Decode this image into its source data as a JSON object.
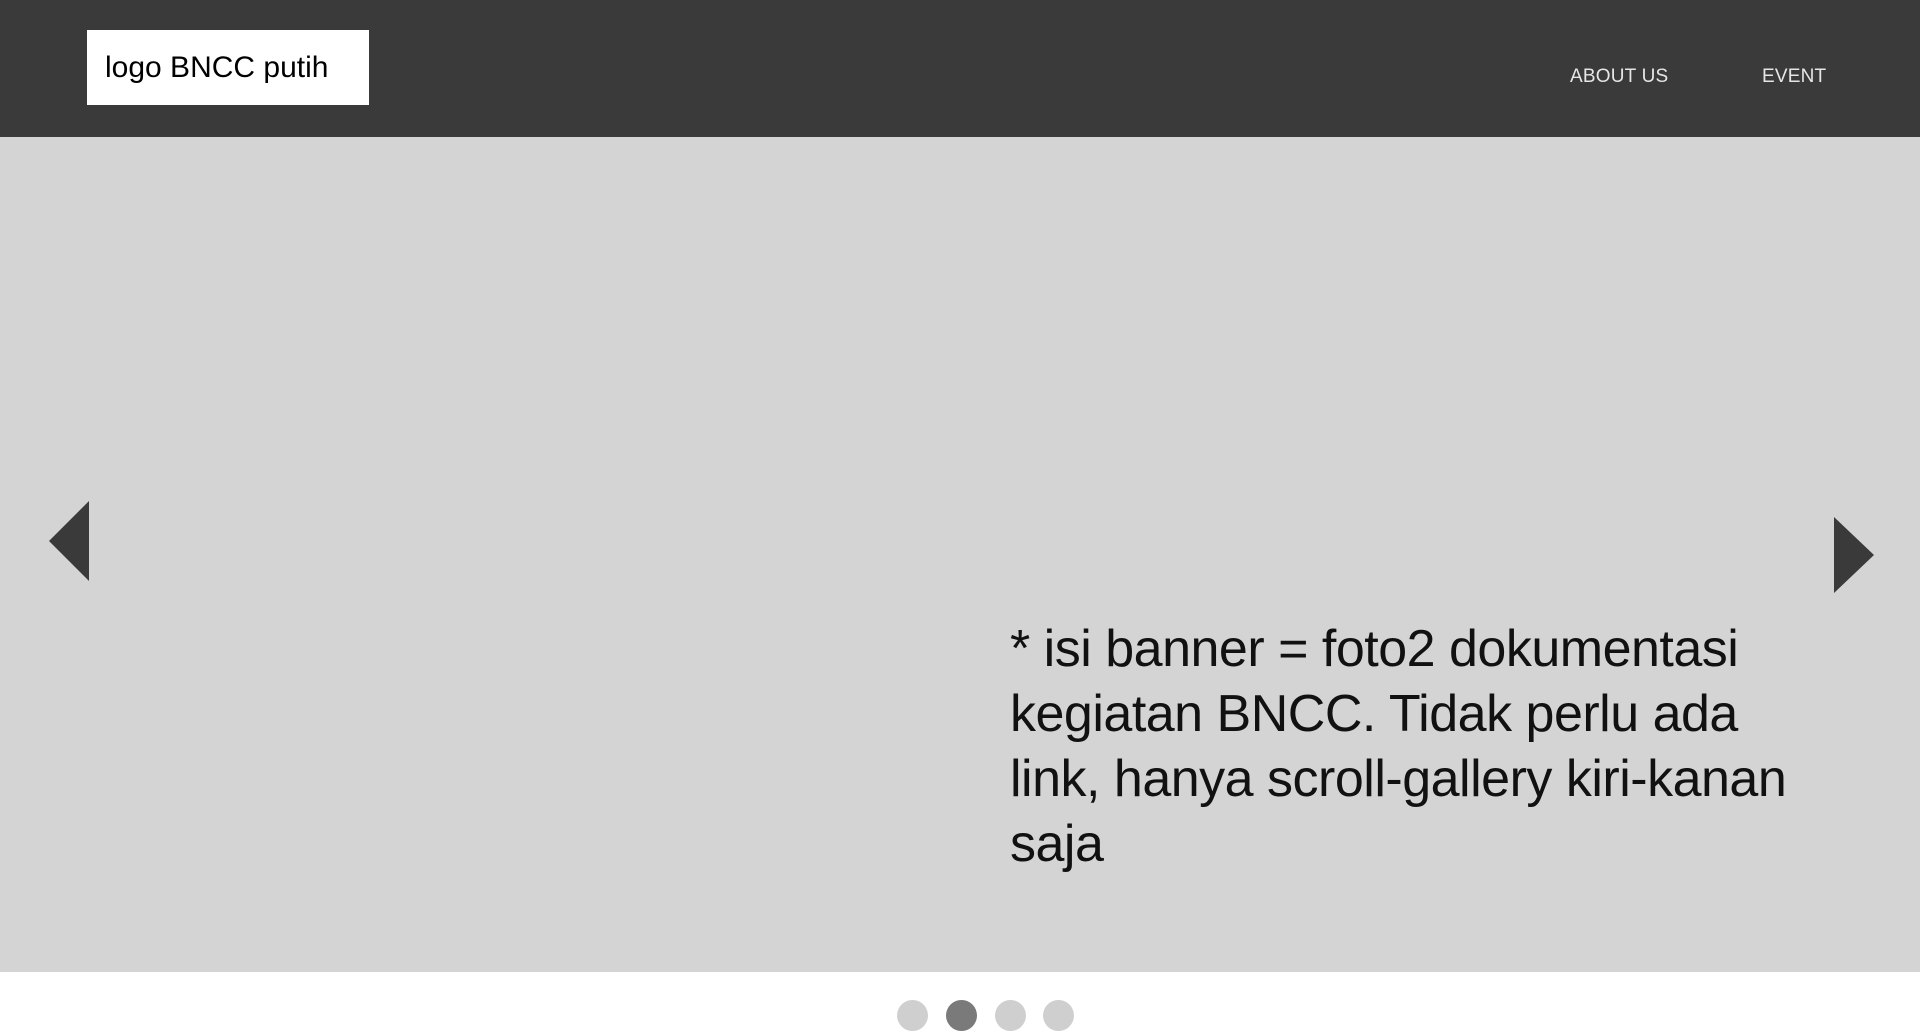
{
  "header": {
    "logo_label": "logo BNCC putih",
    "nav": [
      {
        "label": "ABOUT US"
      },
      {
        "label": "EVENT"
      }
    ]
  },
  "banner": {
    "note": "* isi banner = foto2 dokumentasi\nkegiatan BNCC. Tidak perlu ada\nlink, hanya scroll-gallery kiri-kanan\n saja",
    "prev_icon": "triangle-left-icon",
    "next_icon": "triangle-right-icon"
  },
  "carousel": {
    "slide_count": 4,
    "active_index": 1
  },
  "colors": {
    "header_bg": "#3a3a3a",
    "banner_bg": "#d4d4d4",
    "arrow": "#3a3a3a",
    "dot": "#cfcfcf",
    "dot_active": "#7a7a7a"
  }
}
